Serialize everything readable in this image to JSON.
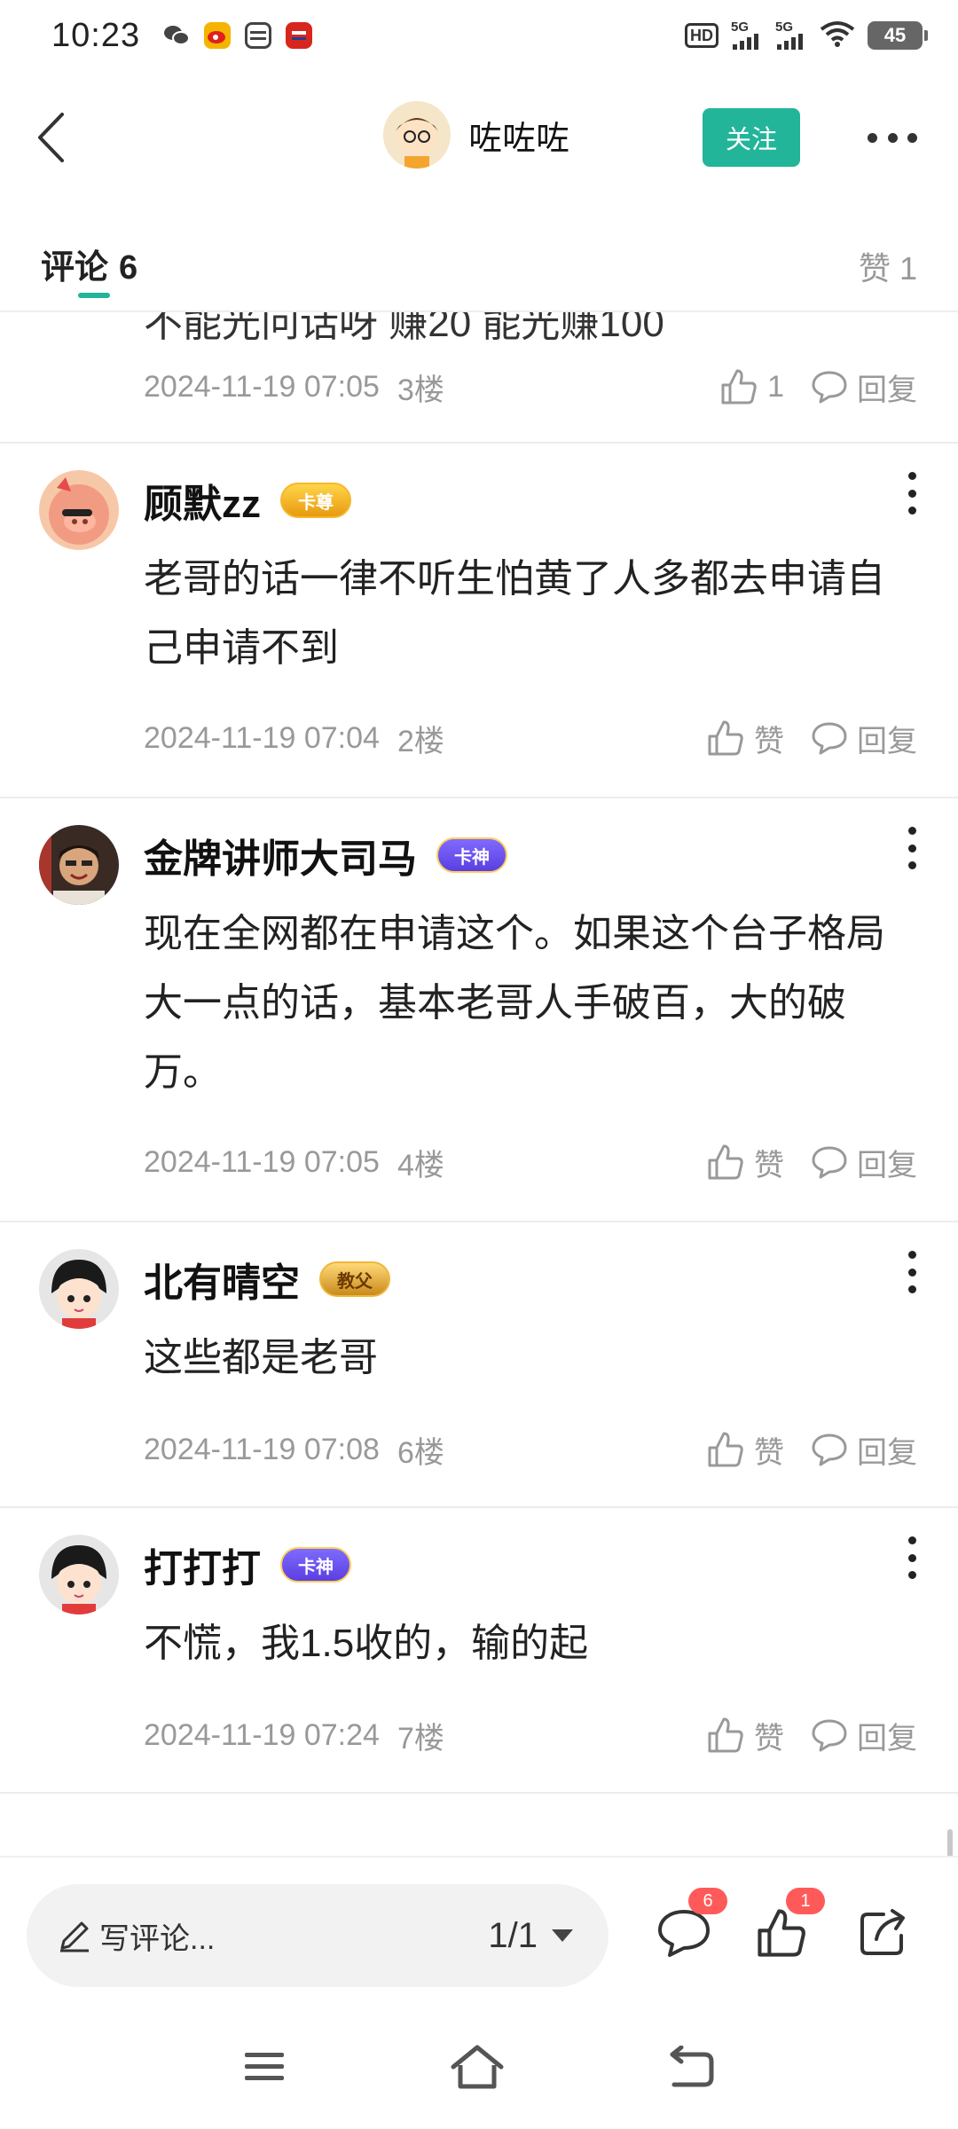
{
  "status_bar": {
    "time": "10:23",
    "battery": "45",
    "network_1": "5G",
    "network_2": "5G",
    "hd": "HD"
  },
  "header": {
    "username": "咗咗咗",
    "follow_label": "关注",
    "icons": [
      "back-icon",
      "more-icon"
    ]
  },
  "tabs": {
    "comments_label": "评论",
    "comments_count": "6",
    "likes_label": "赞",
    "likes_count": "1"
  },
  "partial_comment": {
    "cut_text": "不能光问话呀 赚20 能光赚100",
    "time": "2024-11-19 07:05",
    "floor": "3楼",
    "like_count": "1",
    "reply_label": "回复"
  },
  "comments": [
    {
      "name": "顾默zz",
      "badge": "卡尊",
      "text": "老哥的话一律不听生怕黄了人多都去申请自己申请不到",
      "time": "2024-11-19 07:04",
      "floor": "2楼",
      "like_label": "赞",
      "reply_label": "回复"
    },
    {
      "name": "金牌讲师大司马",
      "badge": "卡神",
      "text": "现在全网都在申请这个。如果这个台子格局大一点的话，基本老哥人手破百，大的破万。",
      "time": "2024-11-19 07:05",
      "floor": "4楼",
      "like_label": "赞",
      "reply_label": "回复"
    },
    {
      "name": "北有晴空",
      "badge": "教父",
      "text": "这些都是老哥",
      "time": "2024-11-19 07:08",
      "floor": "6楼",
      "like_label": "赞",
      "reply_label": "回复"
    },
    {
      "name": "打打打",
      "badge": "卡神",
      "text": "不慌，我1.5收的，输的起",
      "time": "2024-11-19 07:24",
      "floor": "7楼",
      "like_label": "赞",
      "reply_label": "回复"
    }
  ],
  "bottom_bar": {
    "write_placeholder": "写评论...",
    "page_indicator": "1/1",
    "comment_badge": "6",
    "like_badge": "1"
  },
  "colors": {
    "accent": "#22b59a",
    "badge_red": "#ff5a5a",
    "meta_gray": "#999999"
  }
}
